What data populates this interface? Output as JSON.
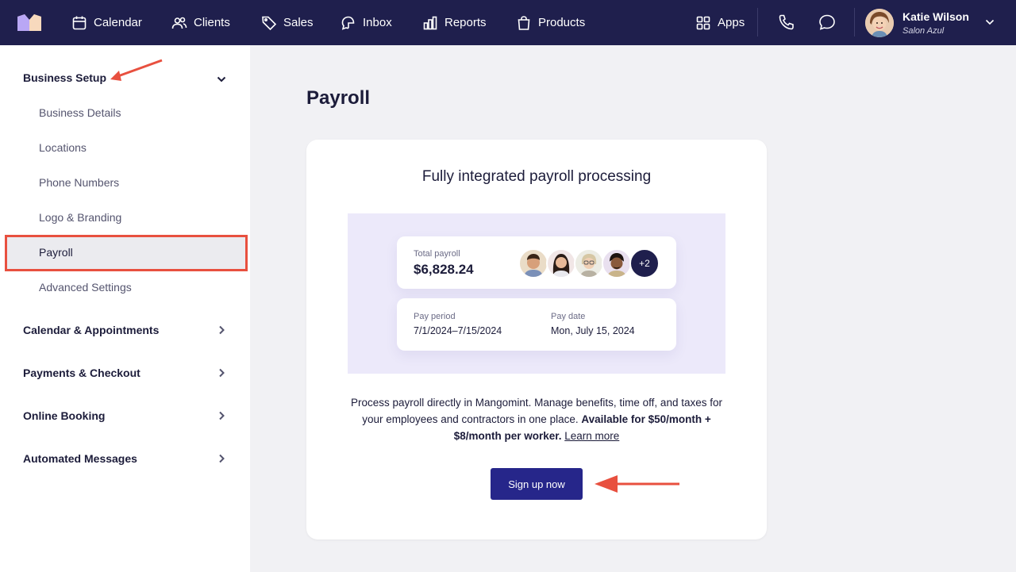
{
  "topbar": {
    "nav": [
      {
        "label": "Calendar",
        "icon": "calendar-icon"
      },
      {
        "label": "Clients",
        "icon": "clients-icon"
      },
      {
        "label": "Sales",
        "icon": "tag-icon"
      },
      {
        "label": "Inbox",
        "icon": "inbox-icon"
      },
      {
        "label": "Reports",
        "icon": "reports-icon"
      },
      {
        "label": "Products",
        "icon": "bag-icon"
      }
    ],
    "apps_label": "Apps",
    "user": {
      "name": "Katie Wilson",
      "location": "Salon Azul"
    }
  },
  "sidebar": {
    "sections": [
      {
        "label": "Business Setup",
        "expanded": true
      },
      {
        "label": "Calendar & Appointments",
        "expanded": false
      },
      {
        "label": "Payments & Checkout",
        "expanded": false
      },
      {
        "label": "Online Booking",
        "expanded": false
      },
      {
        "label": "Automated Messages",
        "expanded": false
      }
    ],
    "business_setup_items": [
      "Business Details",
      "Locations",
      "Phone Numbers",
      "Logo & Branding",
      "Payroll",
      "Advanced Settings"
    ],
    "active_item": "Payroll"
  },
  "main": {
    "page_title": "Payroll",
    "card": {
      "title": "Fully integrated payroll processing",
      "illustration": {
        "total_label": "Total payroll",
        "total_value": "$6,828.24",
        "more_count": "+2",
        "pay_period_label": "Pay period",
        "pay_period_value": "7/1/2024–7/15/2024",
        "pay_date_label": "Pay date",
        "pay_date_value": "Mon, July 15, 2024"
      },
      "description_plain": "Process payroll directly in Mangomint. Manage benefits, time off, and taxes for your employees and contractors in one place.",
      "description_bold": "Available for $50/month + $8/month per worker.",
      "learn_more": "Learn more",
      "cta": "Sign up now"
    }
  },
  "colors": {
    "topbar_bg": "#1f1f4d",
    "accent": "#26268a",
    "annotation": "#e8503f"
  }
}
